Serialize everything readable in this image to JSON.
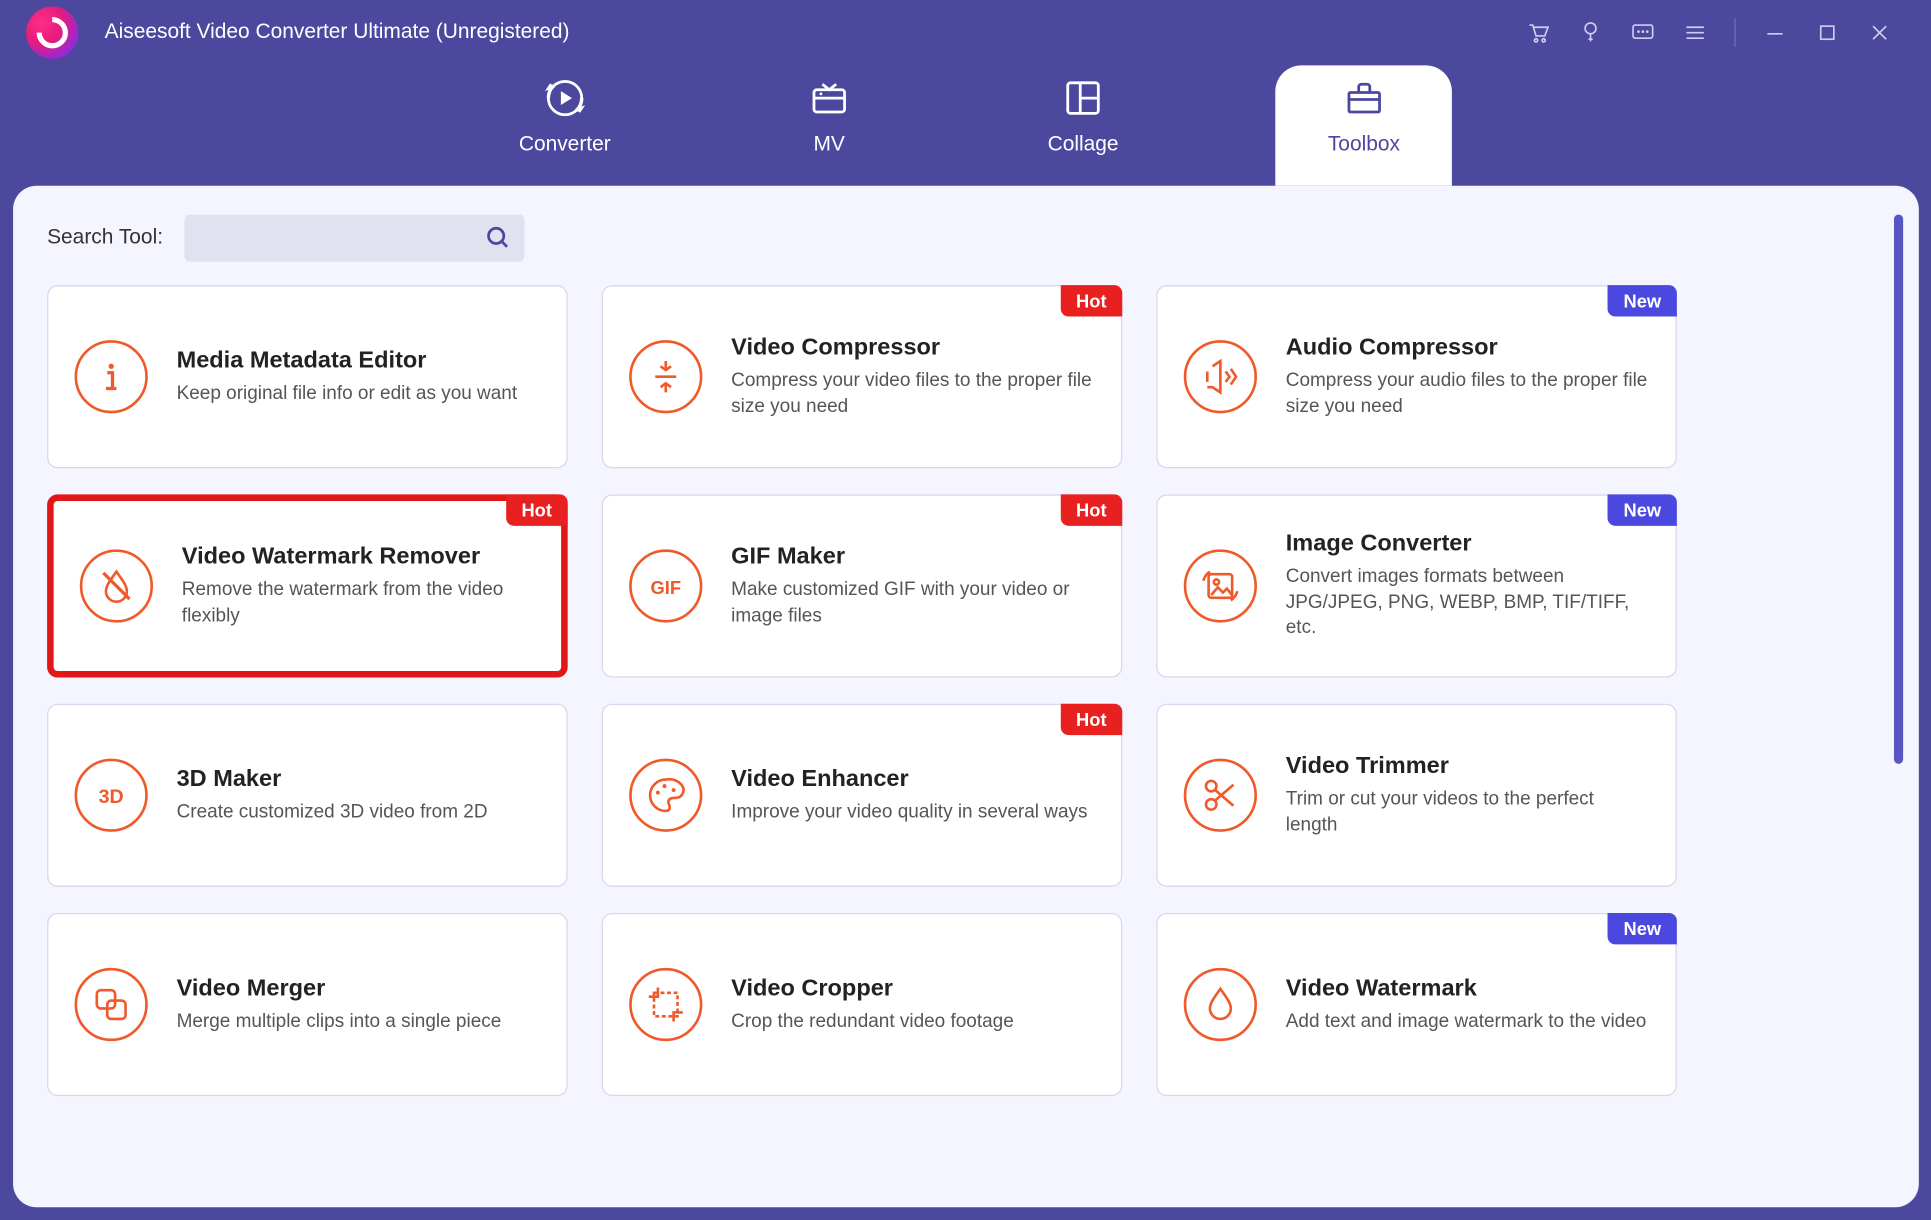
{
  "app_title": "Aiseesoft Video Converter Ultimate (Unregistered)",
  "tabs": {
    "converter": "Converter",
    "mv": "MV",
    "collage": "Collage",
    "toolbox": "Toolbox"
  },
  "search": {
    "label": "Search Tool:",
    "placeholder": ""
  },
  "badges": {
    "hot": "Hot",
    "new": "New"
  },
  "tools": [
    {
      "id": "metadata",
      "title": "Media Metadata Editor",
      "desc": "Keep original file info or edit as you want",
      "badge": null,
      "highlight": false,
      "icon": "info"
    },
    {
      "id": "vcompressor",
      "title": "Video Compressor",
      "desc": "Compress your video files to the proper file size you need",
      "badge": "hot",
      "highlight": false,
      "icon": "compress"
    },
    {
      "id": "acompressor",
      "title": "Audio Compressor",
      "desc": "Compress your audio files to the proper file size you need",
      "badge": "new",
      "highlight": false,
      "icon": "audio"
    },
    {
      "id": "watermark-remover",
      "title": "Video Watermark Remover",
      "desc": "Remove the watermark from the video flexibly",
      "badge": "hot",
      "highlight": true,
      "icon": "drop-slash"
    },
    {
      "id": "gif",
      "title": "GIF Maker",
      "desc": "Make customized GIF with your video or image files",
      "badge": "hot",
      "highlight": false,
      "icon": "gif"
    },
    {
      "id": "imgconv",
      "title": "Image Converter",
      "desc": "Convert images formats between JPG/JPEG, PNG, WEBP, BMP, TIF/TIFF, etc.",
      "badge": "new",
      "highlight": false,
      "icon": "imgconv"
    },
    {
      "id": "3d",
      "title": "3D Maker",
      "desc": "Create customized 3D video from 2D",
      "badge": null,
      "highlight": false,
      "icon": "3d"
    },
    {
      "id": "enhancer",
      "title": "Video Enhancer",
      "desc": "Improve your video quality in several ways",
      "badge": "hot",
      "highlight": false,
      "icon": "palette"
    },
    {
      "id": "trimmer",
      "title": "Video Trimmer",
      "desc": "Trim or cut your videos to the perfect length",
      "badge": null,
      "highlight": false,
      "icon": "scissors"
    },
    {
      "id": "merger",
      "title": "Video Merger",
      "desc": "Merge multiple clips into a single piece",
      "badge": null,
      "highlight": false,
      "icon": "merge"
    },
    {
      "id": "cropper",
      "title": "Video Cropper",
      "desc": "Crop the redundant video footage",
      "badge": null,
      "highlight": false,
      "icon": "crop"
    },
    {
      "id": "watermark",
      "title": "Video Watermark",
      "desc": "Add text and image watermark to the video",
      "badge": "new",
      "highlight": false,
      "icon": "drop"
    }
  ],
  "icon_labels": {
    "info": "info-icon",
    "compress": "compress-icon",
    "audio": "audio-compress-icon",
    "drop-slash": "watermark-remove-icon",
    "gif": "gif-icon",
    "imgconv": "image-convert-icon",
    "3d": "three-d-icon",
    "palette": "palette-icon",
    "scissors": "scissors-icon",
    "merge": "merge-icon",
    "crop": "crop-icon",
    "drop": "drop-icon"
  }
}
